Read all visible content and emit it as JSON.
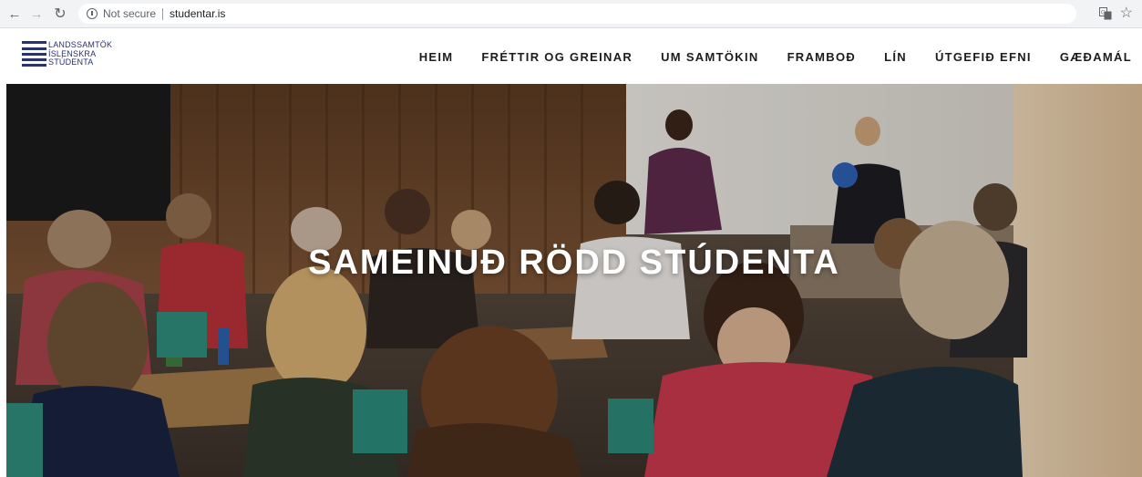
{
  "browser": {
    "back_icon": "arrow-left-icon",
    "forward_icon": "arrow-right-icon",
    "reload_icon": "reload-icon",
    "security_label": "Not secure",
    "url": "studentar.is"
  },
  "site": {
    "logo": {
      "line1": "LANDSSAMTÖK",
      "line2": "ÍSLENSKRA",
      "line3": "STÚDENTA",
      "color": "#2a3270"
    },
    "nav": [
      {
        "label": "HEIM"
      },
      {
        "label": "FRÉTTIR OG GREINAR"
      },
      {
        "label": "UM SAMTÖKIN"
      },
      {
        "label": "FRAMBOÐ"
      },
      {
        "label": "LÍN"
      },
      {
        "label": "ÚTGEFIÐ EFNI"
      },
      {
        "label": "GÆÐAMÁL"
      }
    ]
  },
  "hero": {
    "title": "SAMEINUÐ RÖDD STÚDENTA"
  }
}
